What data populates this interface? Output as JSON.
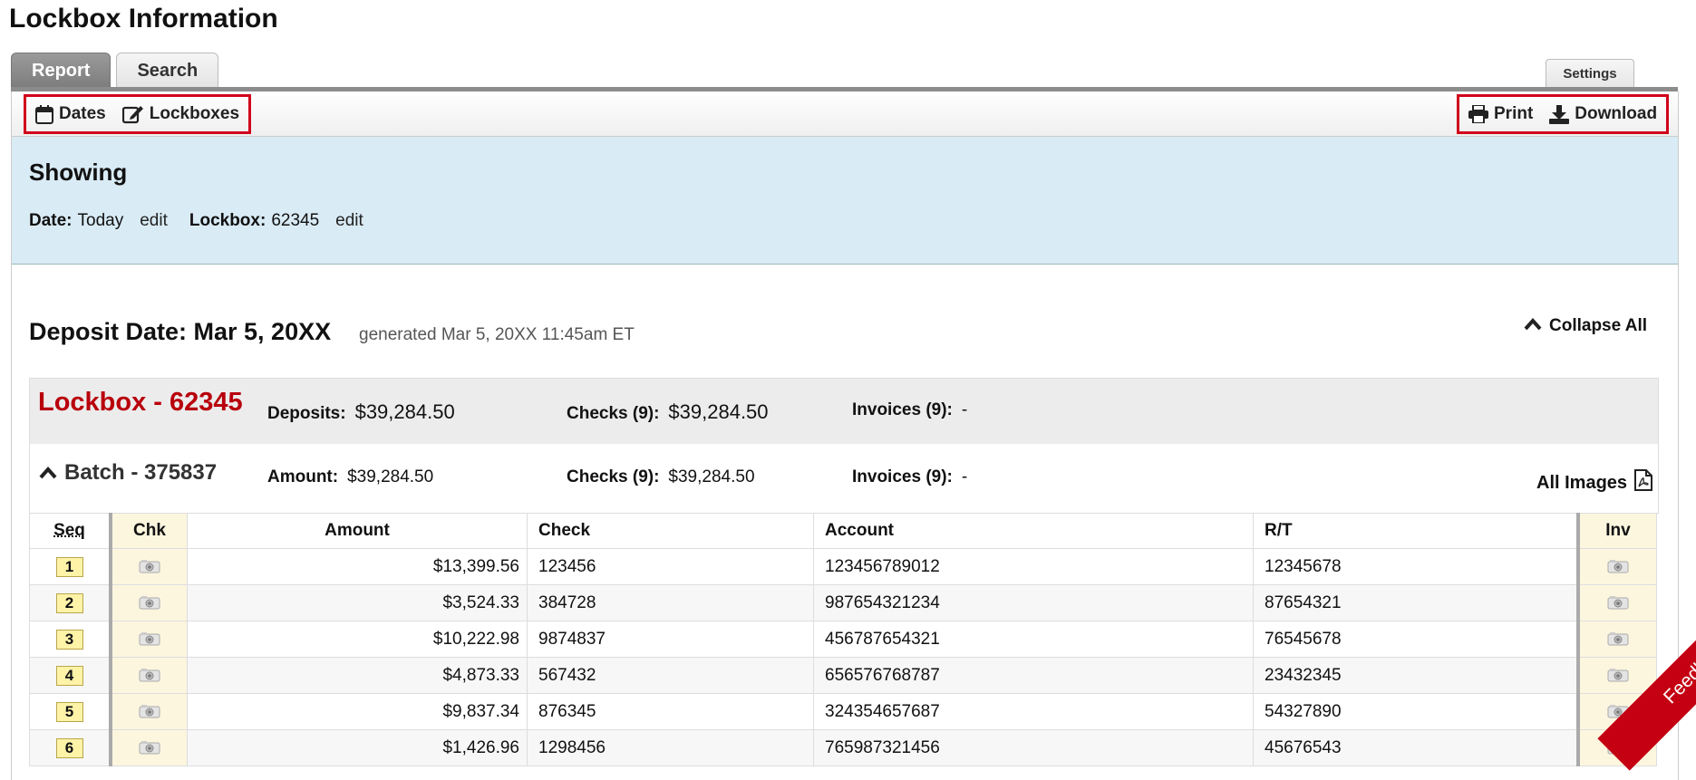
{
  "page": {
    "title": "Lockbox Information"
  },
  "tabs": [
    {
      "label": "Report",
      "active": true
    },
    {
      "label": "Search",
      "active": false
    }
  ],
  "settings_label": "Settings",
  "toolbar": {
    "dates_label": "Dates",
    "lockboxes_label": "Lockboxes",
    "print_label": "Print",
    "download_label": "Download"
  },
  "showing": {
    "heading": "Showing",
    "date_label": "Date:",
    "date_value": "Today",
    "lockbox_label": "Lockbox:",
    "lockbox_value": "62345",
    "edit_label": "edit"
  },
  "deposit": {
    "title": "Deposit Date: Mar 5, 20XX",
    "generated": "generated Mar 5, 20XX 11:45am ET",
    "collapse_label": "Collapse All"
  },
  "lockbox": {
    "title": "Lockbox - 62345",
    "deposits_label": "Deposits:",
    "deposits_value": "$39,284.50",
    "checks_label": "Checks (9):",
    "checks_value": "$39,284.50",
    "invoices_label": "Invoices (9):",
    "invoices_value": "-"
  },
  "batch": {
    "title": "Batch - 375837",
    "amount_label": "Amount:",
    "amount_value": "$39,284.50",
    "checks_label": "Checks (9):",
    "checks_value": "$39,284.50",
    "invoices_label": "Invoices (9):",
    "invoices_value": "-",
    "all_images_label": "All Images"
  },
  "table": {
    "headers": {
      "seq": "Seq",
      "chk": "Chk",
      "amount": "Amount",
      "check": "Check",
      "account": "Account",
      "rt": "R/T",
      "inv": "Inv"
    },
    "rows": [
      {
        "seq": "1",
        "amount": "$13,399.56",
        "check": "123456",
        "account": "123456789012",
        "rt": "12345678"
      },
      {
        "seq": "2",
        "amount": "$3,524.33",
        "check": "384728",
        "account": "987654321234",
        "rt": "87654321"
      },
      {
        "seq": "3",
        "amount": "$10,222.98",
        "check": "9874837",
        "account": "456787654321",
        "rt": "76545678"
      },
      {
        "seq": "4",
        "amount": "$4,873.33",
        "check": "567432",
        "account": "656576768787",
        "rt": "23432345"
      },
      {
        "seq": "5",
        "amount": "$9,837.34",
        "check": "876345",
        "account": "324354657687",
        "rt": "54327890"
      },
      {
        "seq": "6",
        "amount": "$1,426.96",
        "check": "1298456",
        "account": "765987321456",
        "rt": "45676543"
      }
    ]
  },
  "feedback_label": "Feedback",
  "colors": {
    "accent_red": "#b8000c",
    "highlight_border": "#d0021b",
    "showing_bg": "#d9ebf5",
    "image_col_bg": "#fcf6df"
  }
}
